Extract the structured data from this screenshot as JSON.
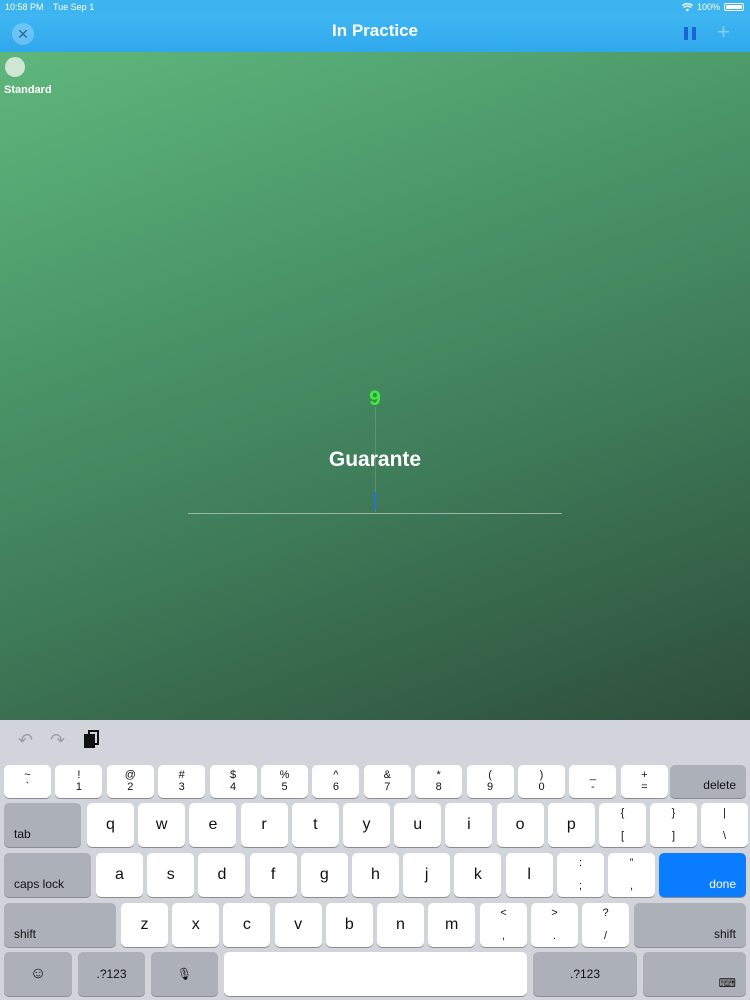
{
  "status": {
    "time": "10:58 PM",
    "date": "Tue Sep 1",
    "battery": "100%"
  },
  "nav": {
    "title": "In Practice",
    "close_glyph": "✕",
    "add_glyph": "+"
  },
  "mode": {
    "label": "Standard"
  },
  "practice": {
    "counter": "9",
    "word": "Guarante",
    "answer_value": ""
  },
  "keyboard": {
    "number_row": [
      {
        "top": "~",
        "bottom": "`"
      },
      {
        "top": "!",
        "bottom": "1"
      },
      {
        "top": "@",
        "bottom": "2"
      },
      {
        "top": "#",
        "bottom": "3"
      },
      {
        "top": "$",
        "bottom": "4"
      },
      {
        "top": "%",
        "bottom": "5"
      },
      {
        "top": "^",
        "bottom": "6"
      },
      {
        "top": "&",
        "bottom": "7"
      },
      {
        "top": "*",
        "bottom": "8"
      },
      {
        "top": "(",
        "bottom": "9"
      },
      {
        "top": ")",
        "bottom": "0"
      },
      {
        "top": "_",
        "bottom": "-"
      },
      {
        "top": "+",
        "bottom": "="
      }
    ],
    "delete_label": "delete",
    "tab_label": "tab",
    "row_q": [
      "q",
      "w",
      "e",
      "r",
      "t",
      "y",
      "u",
      "i",
      "o",
      "p"
    ],
    "row_q_extra": [
      {
        "top": "{",
        "bottom": "["
      },
      {
        "top": "}",
        "bottom": "]"
      },
      {
        "top": "|",
        "bottom": "\\"
      }
    ],
    "caps_label": "caps lock",
    "row_a": [
      "a",
      "s",
      "d",
      "f",
      "g",
      "h",
      "j",
      "k",
      "l"
    ],
    "row_a_extra": [
      {
        "top": ":",
        "bottom": ";"
      },
      {
        "top": "”",
        "bottom": ","
      }
    ],
    "done_label": "done",
    "shift_label": "shift",
    "row_z": [
      "z",
      "x",
      "c",
      "v",
      "b",
      "n",
      "m"
    ],
    "row_z_extra": [
      {
        "top": "<",
        "bottom": ","
      },
      {
        "top": ">",
        "bottom": "."
      },
      {
        "top": "?",
        "bottom": "/"
      }
    ],
    "num_label": ".?123",
    "emoji_glyph": "☺",
    "mic_glyph": "🎙",
    "kb_glyph": "⌨",
    "undo_glyph": "↶",
    "redo_glyph": "↷"
  },
  "colors": {
    "nav": "#3cb4ef",
    "accent": "#0a7cff",
    "counter": "#38f238"
  }
}
